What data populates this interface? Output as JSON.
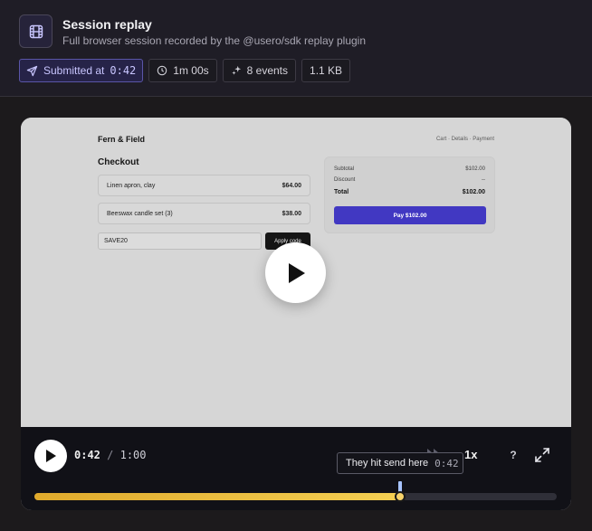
{
  "header": {
    "icon": "film-icon",
    "title": "Session replay",
    "subtitle": "Full browser session recorded by the @usero/sdk replay plugin"
  },
  "chips": {
    "submitted_label": "Submitted at",
    "submitted_time": "0:42",
    "duration": "1m 00s",
    "events": "8 events",
    "size": "1.1 KB"
  },
  "page": {
    "brand": "Fern & Field",
    "breadcrumbs": "Cart · Details · Payment",
    "heading": "Checkout",
    "items": [
      {
        "name": "Linen apron, clay",
        "price": "$64.00"
      },
      {
        "name": "Beeswax candle set (3)",
        "price": "$38.00"
      }
    ],
    "coupon_value": "SAVE20",
    "apply_label": "Apply code",
    "summary": {
      "subtotal_label": "Subtotal",
      "subtotal_value": "$102.00",
      "discount_label": "Discount",
      "discount_value": "--",
      "total_label": "Total",
      "total_value": "$102.00"
    },
    "pay_label": "Pay $102.00"
  },
  "player": {
    "current_time": "0:42",
    "separator": "/",
    "duration": "1:00",
    "speed": "1x",
    "help": "?",
    "progress": 0.7,
    "marker_tooltip": "They hit send here",
    "marker_time": "0:42"
  },
  "colors": {
    "accent": "#4138c2",
    "progress": "#f4cf52",
    "marker": "#a8c4ff"
  }
}
